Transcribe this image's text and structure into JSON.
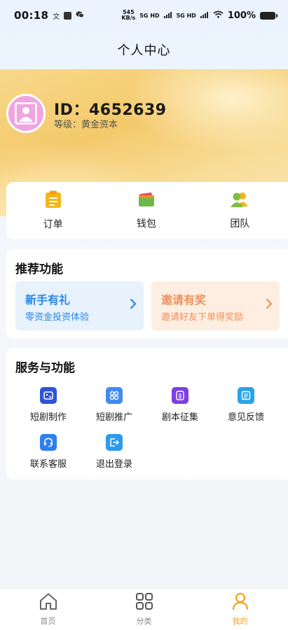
{
  "status_bar": {
    "time": "00:18",
    "mini1": "文",
    "net_speed_value": "545",
    "net_speed_unit": "KB/s",
    "signal1": "5G HD",
    "signal2": "5G HD",
    "battery": "100%"
  },
  "nav": {
    "title": "个人中心"
  },
  "profile": {
    "id_text": "ID：4652639",
    "level_text": "等级：黄金资本"
  },
  "quick_actions": [
    {
      "label": "订单",
      "icon": "clipboard-icon"
    },
    {
      "label": "钱包",
      "icon": "wallet-icon"
    },
    {
      "label": "团队",
      "icon": "team-icon"
    }
  ],
  "recommended": {
    "title": "推荐功能",
    "cards": [
      {
        "title": "新手有礼",
        "subtitle": "零资金投资体验",
        "color": "#2b87e3"
      },
      {
        "title": "邀请有奖",
        "subtitle": "邀请好友下单得奖励",
        "color": "#f0905a"
      }
    ]
  },
  "services": {
    "title": "服务与功能",
    "items": [
      {
        "label": "短剧制作",
        "icon": "drama-production-icon",
        "color": "#2f55d4"
      },
      {
        "label": "短剧推广",
        "icon": "drama-promotion-icon",
        "color": "#3f8bf0"
      },
      {
        "label": "剧本征集",
        "icon": "script-collection-icon",
        "color": "#7b3fe4"
      },
      {
        "label": "意见反馈",
        "icon": "feedback-icon",
        "color": "#29a3e8"
      },
      {
        "label": "联系客服",
        "icon": "customer-service-icon",
        "color": "#2f7ff0"
      },
      {
        "label": "退出登录",
        "icon": "logout-icon",
        "color": "#2c9af0"
      }
    ]
  },
  "tab_bar": {
    "tabs": [
      {
        "label": "首页",
        "icon": "home-icon",
        "active": false
      },
      {
        "label": "分类",
        "icon": "category-grid-icon",
        "active": false
      },
      {
        "label": "我的",
        "icon": "user-icon",
        "active": true
      }
    ],
    "active_color": "#f5a21b"
  }
}
